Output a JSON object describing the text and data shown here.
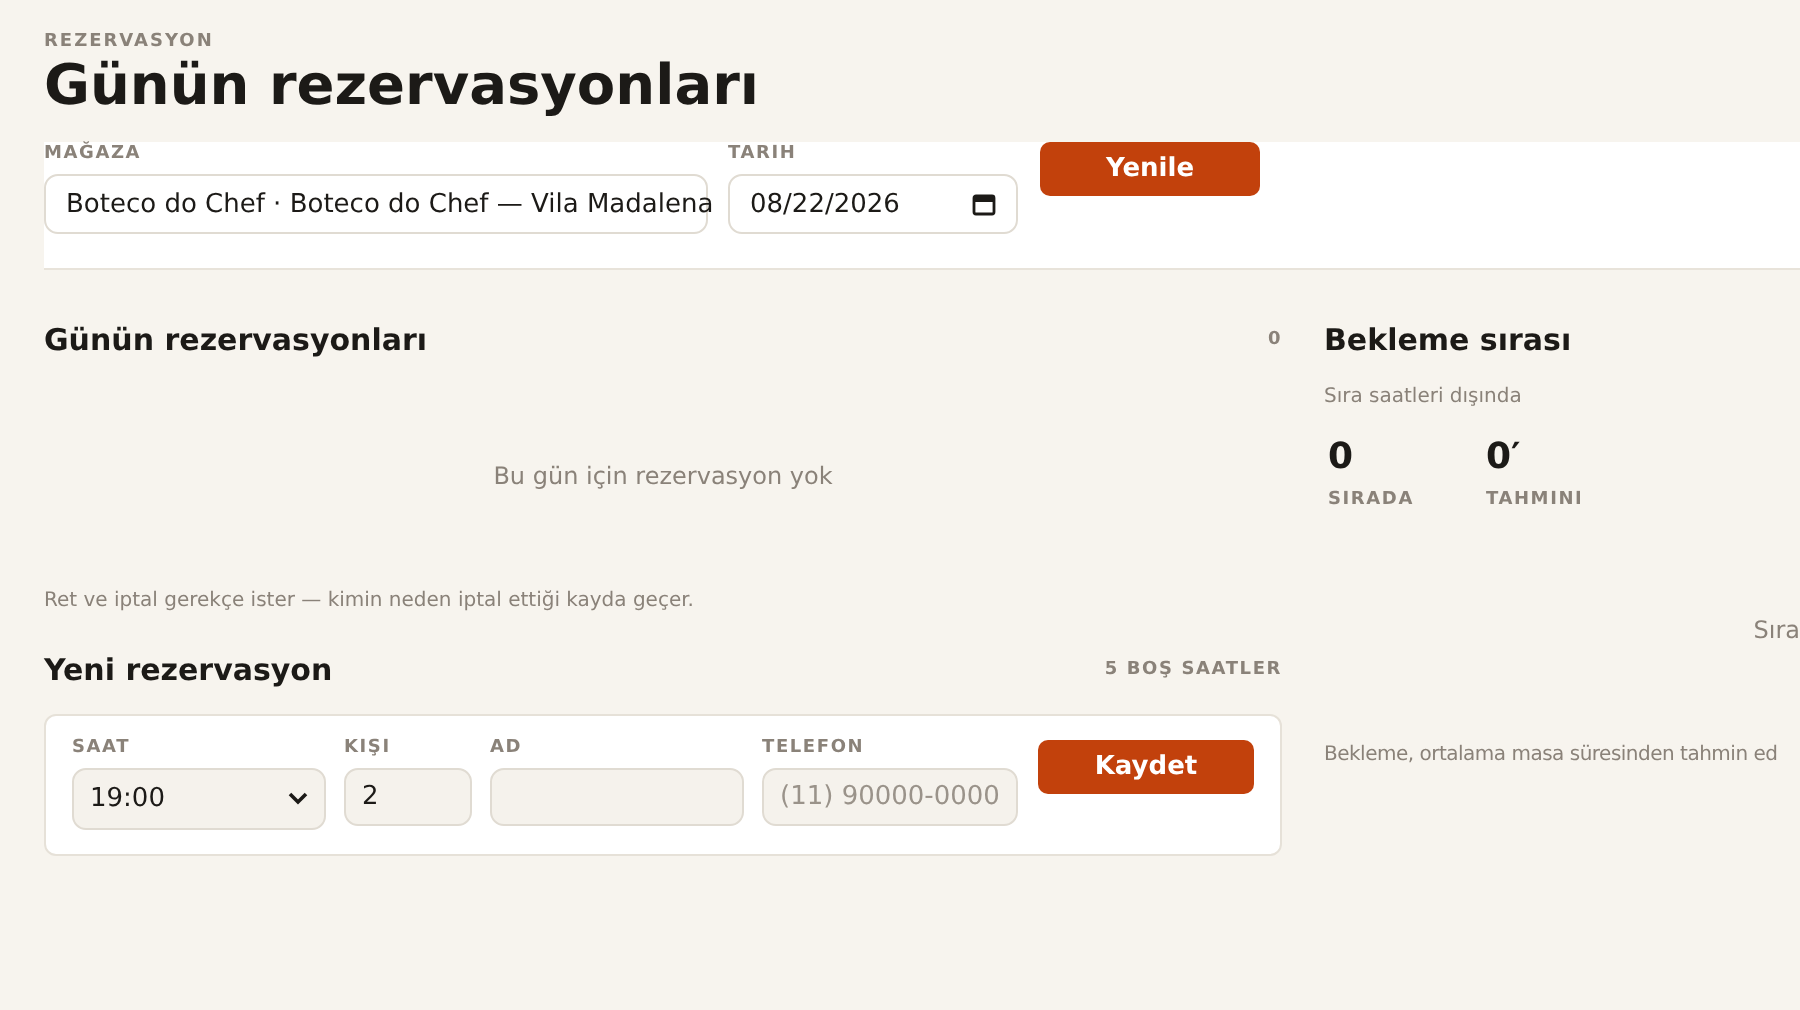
{
  "header": {
    "eyebrow": "REZERVASYON",
    "title": "Günün rezervasyonları"
  },
  "filters": {
    "store": {
      "label": "MAĞAZA",
      "value": "Boteco do Chef · Boteco do Chef — Vila Madalena"
    },
    "date": {
      "label": "TARIH",
      "value": "08/22/2026"
    },
    "refresh_button": "Yenile"
  },
  "reservations": {
    "title": "Günün rezervasyonları",
    "count": "0",
    "empty_text": "Bu gün için rezervasyon yok",
    "note": "Ret ve iptal gerekçe ister — kimin neden iptal ettiği kayda geçer."
  },
  "new_reservation": {
    "title": "Yeni rezervasyon",
    "free_slots": "5 BOŞ SAATLER",
    "fields": [
      {
        "kind": "select",
        "label": "SAAT",
        "value": "19:00"
      },
      {
        "kind": "input",
        "label": "KIŞI",
        "value": "2"
      },
      {
        "kind": "input",
        "label": "AD"
      },
      {
        "kind": "input",
        "label": "TELEFON",
        "placeholder": "(11) 90000-0000"
      }
    ],
    "save_button": "Kaydet"
  },
  "waitlist": {
    "title": "Bekleme sırası",
    "status": "Sıra saatleri dışında",
    "stats": [
      {
        "value": "0",
        "label": "SIRADA"
      },
      {
        "value": "0′",
        "label": "TAHMINI"
      }
    ],
    "empty_text": "Sıra",
    "footnote": "Bekleme, ortalama masa süresinden tahmin ed"
  }
}
